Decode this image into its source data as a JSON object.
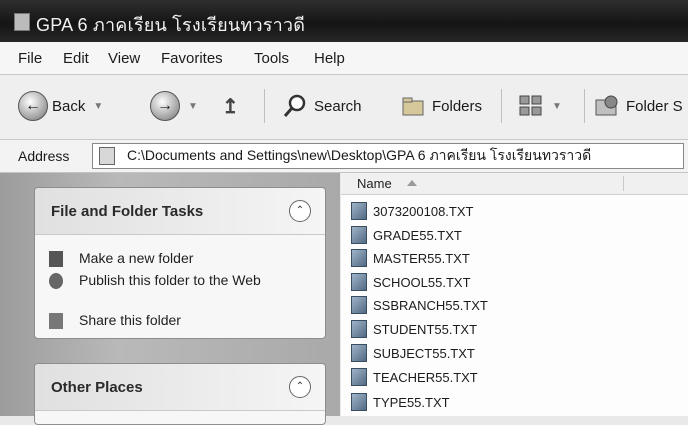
{
  "window": {
    "title": "GPA 6 ภาคเรียน โรงเรียนทวราวดี"
  },
  "menubar": {
    "items": [
      "File",
      "Edit",
      "View",
      "Favorites",
      "Tools",
      "Help"
    ]
  },
  "toolbar": {
    "back_label": "Back",
    "search_label": "Search",
    "folders_label": "Folders",
    "folder_sync_label": "Folder S"
  },
  "address": {
    "label": "Address",
    "path": "C:\\Documents and Settings\\new\\Desktop\\GPA 6 ภาคเรียน โรงเรียนทวราวดี"
  },
  "tasks_panel": {
    "title": "File and Folder Tasks",
    "items": [
      "Make a new folder",
      "Publish this folder to the Web",
      "Share this folder"
    ]
  },
  "other_places": {
    "title": "Other Places"
  },
  "file_list": {
    "column_name": "Name",
    "files": [
      "3073200108.TXT",
      "GRADE55.TXT",
      "MASTER55.TXT",
      "SCHOOL55.TXT",
      "SSBRANCH55.TXT",
      "STUDENT55.TXT",
      "SUBJECT55.TXT",
      "TEACHER55.TXT",
      "TYPE55.TXT"
    ]
  }
}
